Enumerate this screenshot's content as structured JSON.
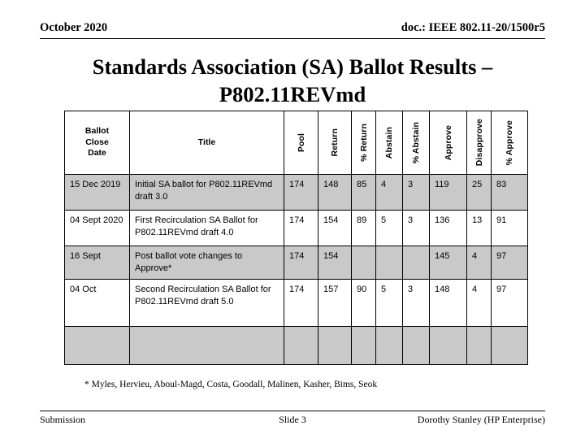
{
  "header": {
    "left": "October 2020",
    "right": "doc.: IEEE 802.11-20/1500r5"
  },
  "title": {
    "line1": "Standards Association (SA) Ballot Results –",
    "line2": "P802.11REVmd"
  },
  "table": {
    "columns": [
      {
        "label": "Ballot Close Date",
        "orientation": "horizontal"
      },
      {
        "label": "Title",
        "orientation": "horizontal"
      },
      {
        "label": "Pool",
        "orientation": "vertical"
      },
      {
        "label": "Return",
        "orientation": "vertical"
      },
      {
        "label": "% Return",
        "orientation": "vertical"
      },
      {
        "label": "Abstain",
        "orientation": "vertical"
      },
      {
        "label": "% Abstain",
        "orientation": "vertical"
      },
      {
        "label": "Approve",
        "orientation": "vertical"
      },
      {
        "label": "Disapprove",
        "orientation": "vertical"
      },
      {
        "label": "% Approve",
        "orientation": "vertical"
      }
    ],
    "header_cells": {
      "c0_line1": "Ballot",
      "c0_line2": "Close",
      "c0_line3": "Date",
      "c1": "Title",
      "c2": "Pool",
      "c3": "Return",
      "c4": "% Return",
      "c5": "Abstain",
      "c6": "% Abstain",
      "c7": "Approve",
      "c8": "Disapprove",
      "c9": "% Approve"
    },
    "rows": [
      {
        "date": "15 Dec 2019",
        "title": "Initial SA ballot for P802.11REVmd draft 3.0",
        "pool": "174",
        "return": "148",
        "pct_return": "85",
        "abstain": "4",
        "pct_abstain": "3",
        "approve": "119",
        "disapprove": "25",
        "pct_approve": "83"
      },
      {
        "date": "04 Sept 2020",
        "title": "First Recirculation SA  Ballot for P802.11REVmd draft 4.0",
        "pool": "174",
        "return": "154",
        "pct_return": "89",
        "abstain": "5",
        "pct_abstain": "3",
        "approve": "136",
        "disapprove": "13",
        "pct_approve": "91"
      },
      {
        "date": "16 Sept",
        "title": "Post ballot vote changes to Approve*",
        "pool": "174",
        "return": "154",
        "pct_return": "",
        "abstain": "",
        "pct_abstain": "",
        "approve": "145",
        "disapprove": "4",
        "pct_approve": "97"
      },
      {
        "date": "04 Oct",
        "title": "Second Recirculation SA Ballot for P802.11REVmd draft 5.0",
        "pool": "174",
        "return": "157",
        "pct_return": "90",
        "abstain": "5",
        "pct_abstain": "3",
        "approve": "148",
        "disapprove": "4",
        "pct_approve": "97"
      },
      {
        "date": "",
        "title": "",
        "pool": "",
        "return": "",
        "pct_return": "",
        "abstain": "",
        "pct_abstain": "",
        "approve": "",
        "disapprove": "",
        "pct_approve": ""
      }
    ]
  },
  "footnote": "* Myles, Hervieu, Aboul-Magd, Costa, Goodall, Malinen, Kasher, Bims, Seok",
  "footer": {
    "left": "Submission",
    "center": "Slide 3",
    "right": "Dorothy Stanley (HP Enterprise)"
  },
  "colors": {
    "row_shaded": "#c9c9c9",
    "row_plain": "#ffffff",
    "border": "#000000",
    "text": "#000000"
  }
}
